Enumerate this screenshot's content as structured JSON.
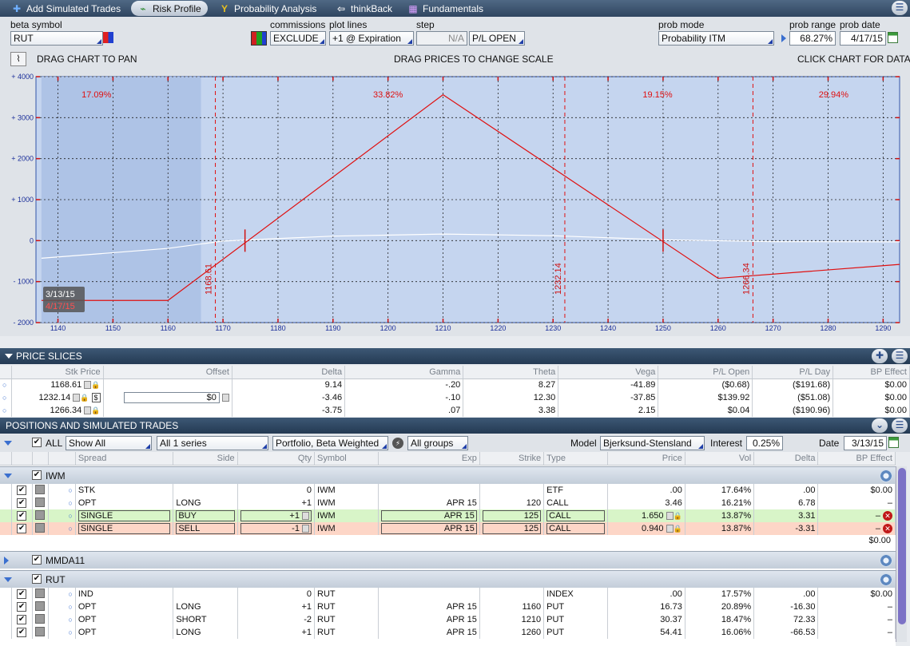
{
  "nav": {
    "tabs": [
      {
        "label": "Add Simulated Trades",
        "icon": "plus-icon"
      },
      {
        "label": "Risk Profile",
        "icon": "chart-icon"
      },
      {
        "label": "Probability Analysis",
        "icon": "y-icon"
      },
      {
        "label": "thinkBack",
        "icon": "back-icon"
      },
      {
        "label": "Fundamentals",
        "icon": "building-icon"
      }
    ]
  },
  "controls": {
    "beta_symbol_label": "beta symbol",
    "beta_symbol": "RUT",
    "commissions_label": "commissions",
    "commissions": "EXCLUDE",
    "plot_lines_label": "plot lines",
    "plot_lines": "+1 @ Expiration",
    "step_label": "step",
    "step": "N/A",
    "pl_mode": "P/L OPEN",
    "prob_mode_label": "prob mode",
    "prob_mode": "Probability ITM",
    "prob_range_label": "prob range",
    "prob_range": "68.27%",
    "prob_date_label": "prob date",
    "prob_date": "4/17/15",
    "hint_pan": "DRAG CHART TO PAN",
    "hint_scale": "DRAG PRICES TO CHANGE SCALE",
    "hint_data": "CLICK CHART FOR DATA"
  },
  "chart_data": {
    "type": "line",
    "xlim": [
      1136,
      1293
    ],
    "ylim": [
      -2000,
      4000
    ],
    "x_ticks": [
      "1140",
      "1150",
      "1160",
      "1170",
      "1180",
      "1190",
      "1200",
      "1210",
      "1220",
      "1230",
      "1240",
      "1250",
      "1260",
      "1270",
      "1280",
      "1290"
    ],
    "y_ticks": [
      "+ 4000",
      "+ 3000",
      "+ 2000",
      "+ 1000",
      "0",
      "- 1000",
      "- 2000"
    ],
    "y_tick_values": [
      4000,
      3000,
      2000,
      1000,
      0,
      -1000,
      -2000
    ],
    "x_tick_values": [
      1140,
      1150,
      1160,
      1170,
      1180,
      1190,
      1200,
      1210,
      1220,
      1230,
      1240,
      1250,
      1260,
      1270,
      1280,
      1290
    ],
    "expiration": {
      "x": [
        1137,
        1160,
        1210,
        1260,
        1293
      ],
      "y": [
        -1460,
        -1460,
        3560,
        -920,
        -580
      ]
    },
    "today": {
      "x": [
        1137,
        1160,
        1170,
        1190,
        1210,
        1230,
        1250,
        1270,
        1293
      ],
      "y": [
        -430,
        -190,
        -10,
        110,
        160,
        120,
        20,
        -25,
        -30
      ]
    },
    "slices": [
      1168.61,
      1232.14,
      1266.34
    ],
    "slice_labels": [
      "1168.61",
      "1232.14",
      "1266.34"
    ],
    "prob_regions": [
      {
        "label": "17.09%",
        "x": 1147
      },
      {
        "label": "33.82%",
        "x": 1200
      },
      {
        "label": "19.15%",
        "x": 1249
      },
      {
        "label": "29.94%",
        "x": 1281
      }
    ],
    "shade_range": [
      1137,
      1166
    ],
    "markers": [
      1174,
      1250
    ],
    "date_today": "3/13/15",
    "date_exp": "4/17/15",
    "grid": true
  },
  "price_slices": {
    "title": "PRICE SLICES",
    "headers": [
      "Stk Price",
      "Offset",
      "Delta",
      "Gamma",
      "Theta",
      "Vega",
      "P/L Open",
      "P/L Day",
      "BP Effect"
    ],
    "rows": [
      [
        "1168.61",
        "",
        "9.14",
        "-.20",
        "8.27",
        "-41.89",
        "($0.68)",
        "($191.68)",
        "$0.00"
      ],
      [
        "1232.14",
        "$0",
        "-3.46",
        "-.10",
        "12.30",
        "-37.85",
        "$139.92",
        "($51.08)",
        "$0.00"
      ],
      [
        "1266.34",
        "",
        "-3.75",
        ".07",
        "3.38",
        "2.15",
        "$0.04",
        "($190.96)",
        "$0.00"
      ]
    ]
  },
  "positions": {
    "title": "POSITIONS AND SIMULATED TRADES",
    "all_label": "ALL",
    "show": "Show All",
    "series": "All 1 series",
    "portfolio": "Portfolio, Beta Weighted",
    "groups": "All groups",
    "model_label": "Model",
    "model": "Bjerksund-Stensland",
    "interest_label": "Interest",
    "interest": "0.25%",
    "date_label": "Date",
    "date": "3/13/15",
    "headers": [
      "Spread",
      "Side",
      "Qty",
      "Symbol",
      "Exp",
      "Strike",
      "Type",
      "Price",
      "Vol",
      "Delta",
      "BP Effect"
    ],
    "groups_list": [
      {
        "name": "IWM",
        "rows": [
          {
            "cls": "rowc",
            "c": [
              "STK",
              "",
              "0",
              "IWM",
              "",
              "",
              "ETF",
              ".00",
              "17.64%",
              ".00",
              "$0.00"
            ]
          },
          {
            "cls": "rowc",
            "c": [
              "OPT",
              "LONG",
              "+1",
              "IWM",
              "APR 15",
              "120",
              "CALL",
              "3.46",
              "16.21%",
              "6.78",
              "–"
            ]
          },
          {
            "cls": "buyrow",
            "c": [
              "SINGLE",
              "BUY",
              "+1",
              "IWM",
              "APR 15",
              "125",
              "CALL",
              "1.650",
              "13.87%",
              "3.31",
              "–"
            ]
          },
          {
            "cls": "sellrow",
            "c": [
              "SINGLE",
              "SELL",
              "-1",
              "IWM",
              "APR 15",
              "125",
              "CALL",
              "0.940",
              "13.87%",
              "-3.31",
              "–"
            ]
          }
        ],
        "total": "$0.00"
      },
      {
        "name": "MMDA11",
        "rows": []
      },
      {
        "name": "RUT",
        "rows": [
          {
            "cls": "rowc",
            "c": [
              "IND",
              "",
              "0",
              "RUT",
              "",
              "",
              "INDEX",
              ".00",
              "17.57%",
              ".00",
              "$0.00"
            ]
          },
          {
            "cls": "rowc",
            "c": [
              "OPT",
              "LONG",
              "+1",
              "RUT",
              "APR 15",
              "1160",
              "PUT",
              "16.73",
              "20.89%",
              "-16.30",
              "–"
            ]
          },
          {
            "cls": "rowc",
            "c": [
              "OPT",
              "SHORT",
              "-2",
              "RUT",
              "APR 15",
              "1210",
              "PUT",
              "30.37",
              "18.47%",
              "72.33",
              "–"
            ]
          },
          {
            "cls": "rowc",
            "c": [
              "OPT",
              "LONG",
              "+1",
              "RUT",
              "APR 15",
              "1260",
              "PUT",
              "54.41",
              "16.06%",
              "-66.53",
              "–"
            ]
          }
        ]
      }
    ]
  }
}
